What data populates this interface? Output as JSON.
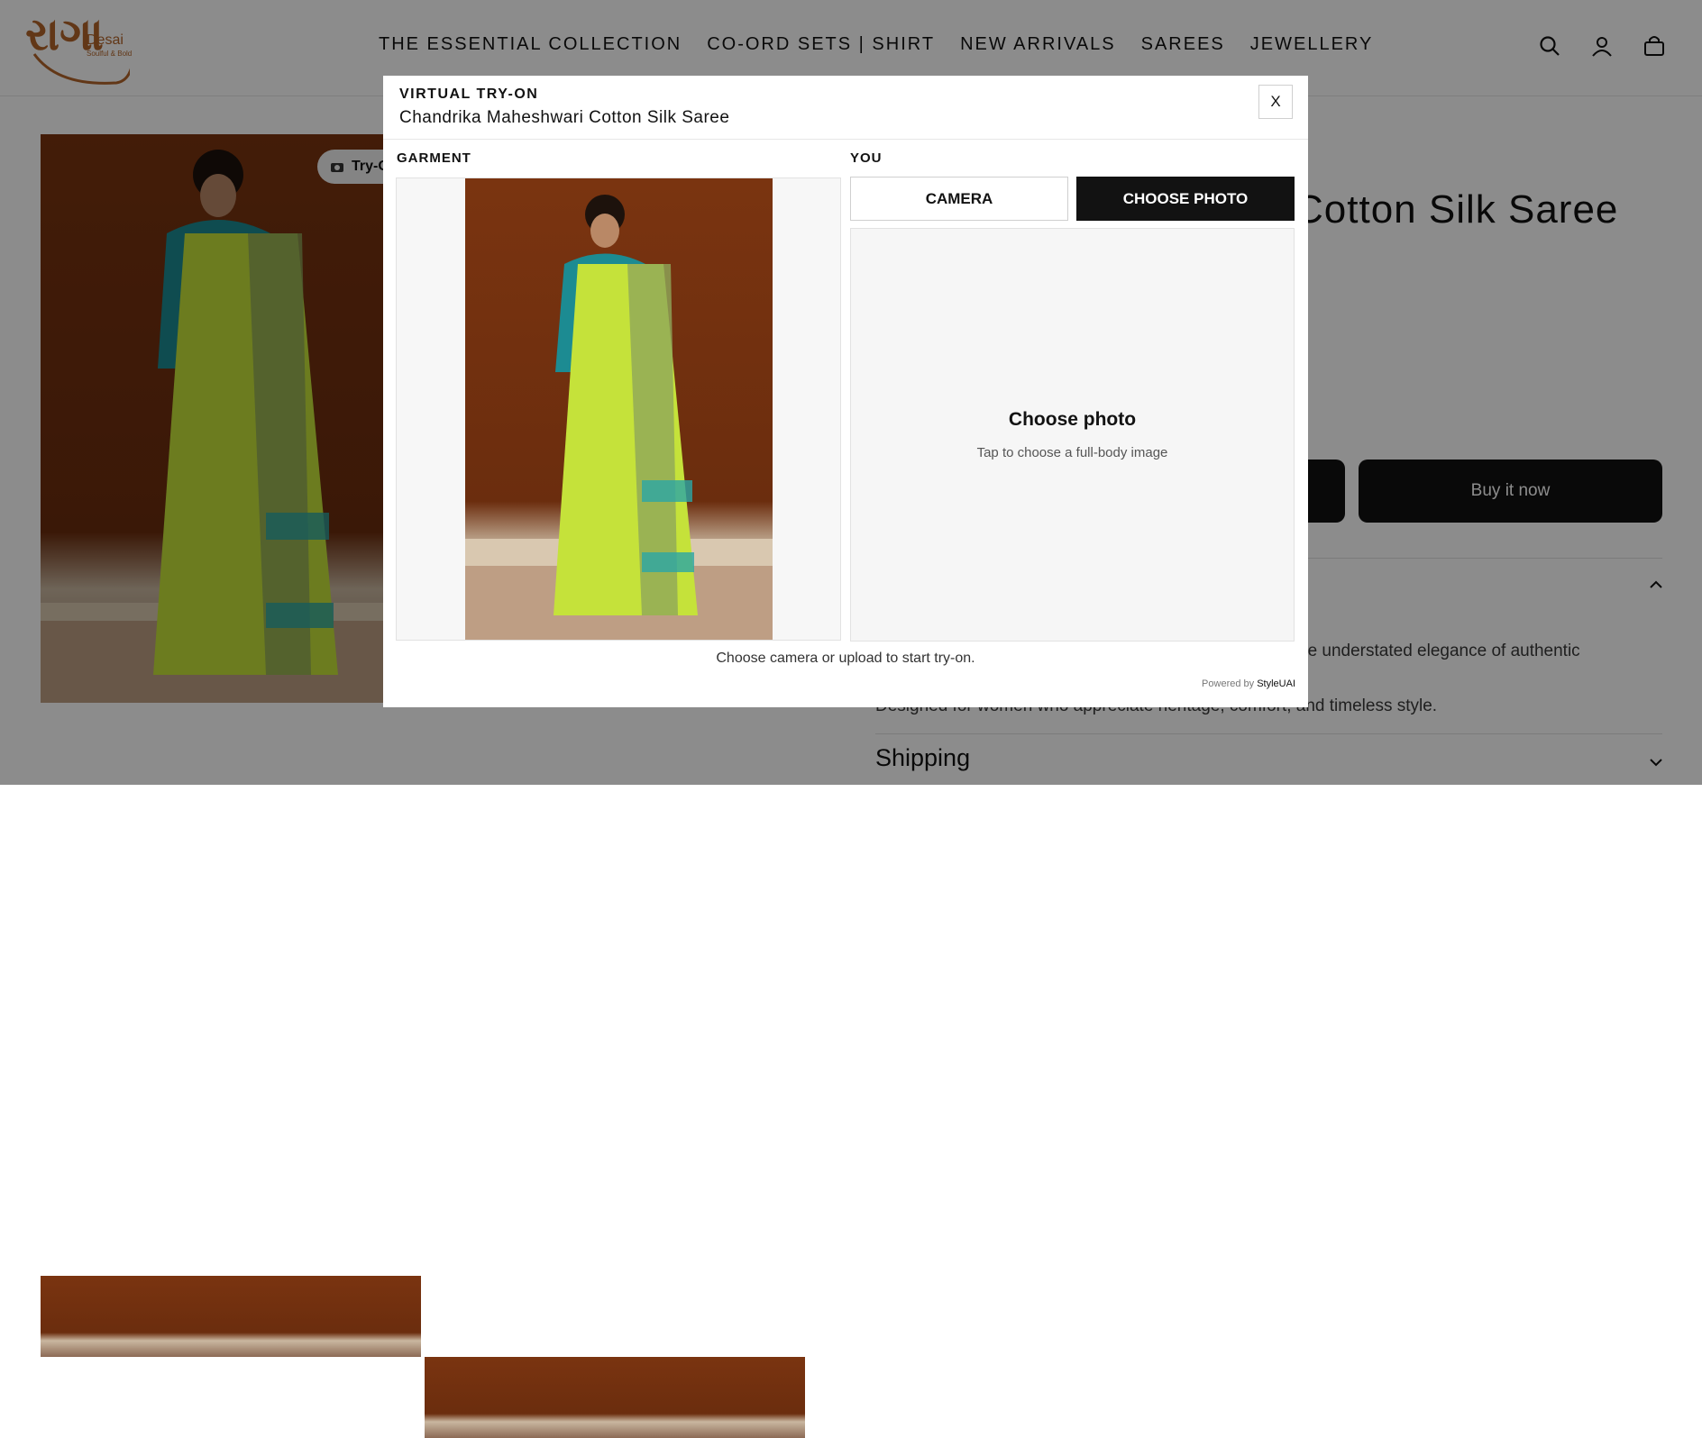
{
  "brand": {
    "logo_text": "રાગા",
    "name": "Desai",
    "tagline": "Soulful & Bold"
  },
  "nav": [
    {
      "label": "THE ESSENTIAL COLLECTION"
    },
    {
      "label": "CO-ORD SETS | SHIRT"
    },
    {
      "label": "NEW ARRIVALS"
    },
    {
      "label": "SAREES"
    },
    {
      "label": "JEWELLERY"
    }
  ],
  "header_icons": [
    "search-icon",
    "account-icon",
    "cart-icon"
  ],
  "product": {
    "title_visible": "Cotton Silk Saree",
    "buy_label": "Buy it now",
    "tryon_label": "Try-O",
    "description_fragment": "he understated elegance of authentic",
    "description_line2": "Designed for women who appreciate heritage, comfort, and timeless style.",
    "shipping_label": "Shipping"
  },
  "modal": {
    "kicker": "VIRTUAL TRY-ON",
    "title": "Chandrika Maheshwari Cotton Silk Saree",
    "close_label": "X",
    "garment_label": "GARMENT",
    "you_label": "YOU",
    "camera_label": "CAMERA",
    "choose_label": "CHOOSE PHOTO",
    "drop_title": "Choose photo",
    "drop_subtitle": "Tap to choose a full-body image",
    "status": "Choose camera or upload to start try-on.",
    "powered_prefix": "Powered by",
    "powered_brand": "StyleUAI"
  },
  "colors": {
    "accent": "#121212",
    "brand": "#b3652a",
    "backdrop": "#7a3410",
    "saree": "#c8e63a",
    "border_teal": "#2aa6a6"
  }
}
